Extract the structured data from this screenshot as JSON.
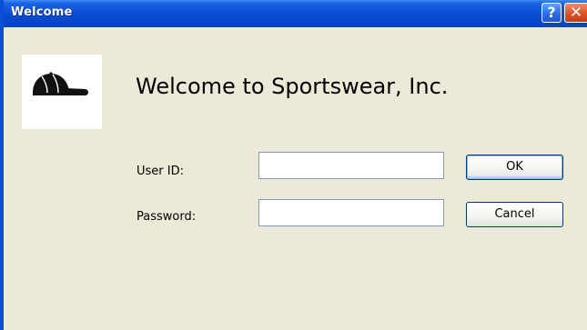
{
  "window": {
    "title": "Welcome",
    "help_glyph": "?",
    "close_glyph": "✕"
  },
  "logo": {
    "icon": "baseball-cap-icon"
  },
  "heading": "Welcome to Sportswear, Inc.",
  "form": {
    "userid_label": "User ID:",
    "userid_value": "",
    "password_label": "Password:",
    "password_value": ""
  },
  "buttons": {
    "ok_label": "OK",
    "cancel_label": "Cancel"
  },
  "colors": {
    "titlebar": "#0a4fd6",
    "window_bg": "#ece9d8",
    "close_button": "#e25a2f"
  }
}
